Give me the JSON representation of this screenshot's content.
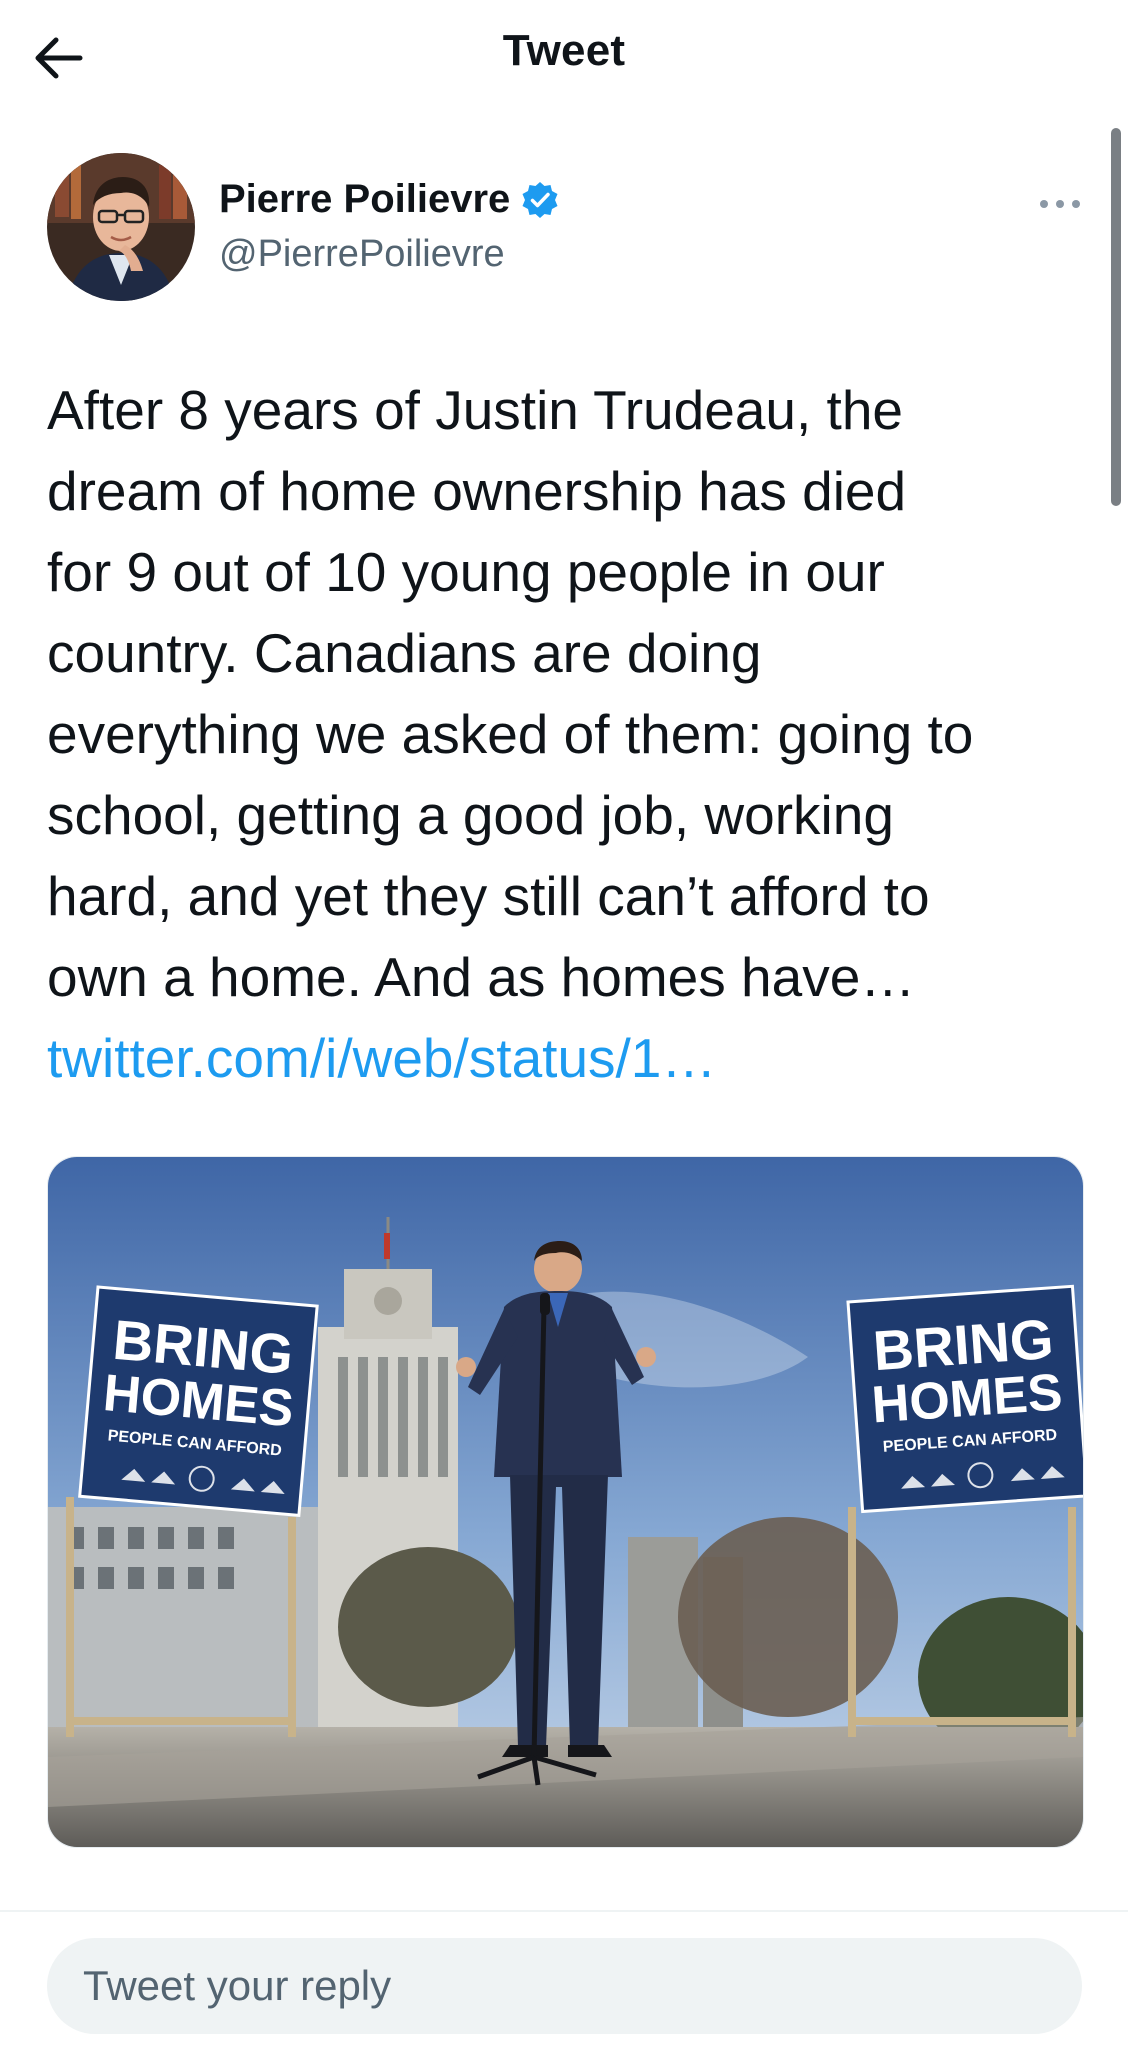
{
  "header": {
    "title": "Tweet",
    "back_icon": "arrow-left-icon"
  },
  "author": {
    "name": "Pierre Poilievre",
    "handle": "@PierrePoilievre",
    "verified_icon": "verified-badge-icon",
    "verified_color": "#1d9bf0",
    "more_icon": "more-horizontal-icon"
  },
  "tweet": {
    "text": "After 8 years of Justin Trudeau, the\ndream of home ownership has died\nfor 9 out of 10 young people in our\ncountry. Canadians are doing\neverything we asked of them: going to\nschool, getting a good job, working\nhard, and yet they still can’t afford to\nown a home. And as homes have…",
    "link": "twitter.com/i/web/status/1…"
  },
  "media": {
    "signs": [
      {
        "line1": "BRING",
        "line2": "HOMES",
        "line3": "PEOPLE CAN AFFORD"
      },
      {
        "line1": "BRING",
        "line2": "HOMES",
        "line3": "PEOPLE CAN AFFORD"
      }
    ]
  },
  "reply": {
    "placeholder": "Tweet your reply"
  },
  "colors": {
    "accent": "#1d9bf0",
    "text": "#0f1419",
    "secondary": "#536471"
  }
}
